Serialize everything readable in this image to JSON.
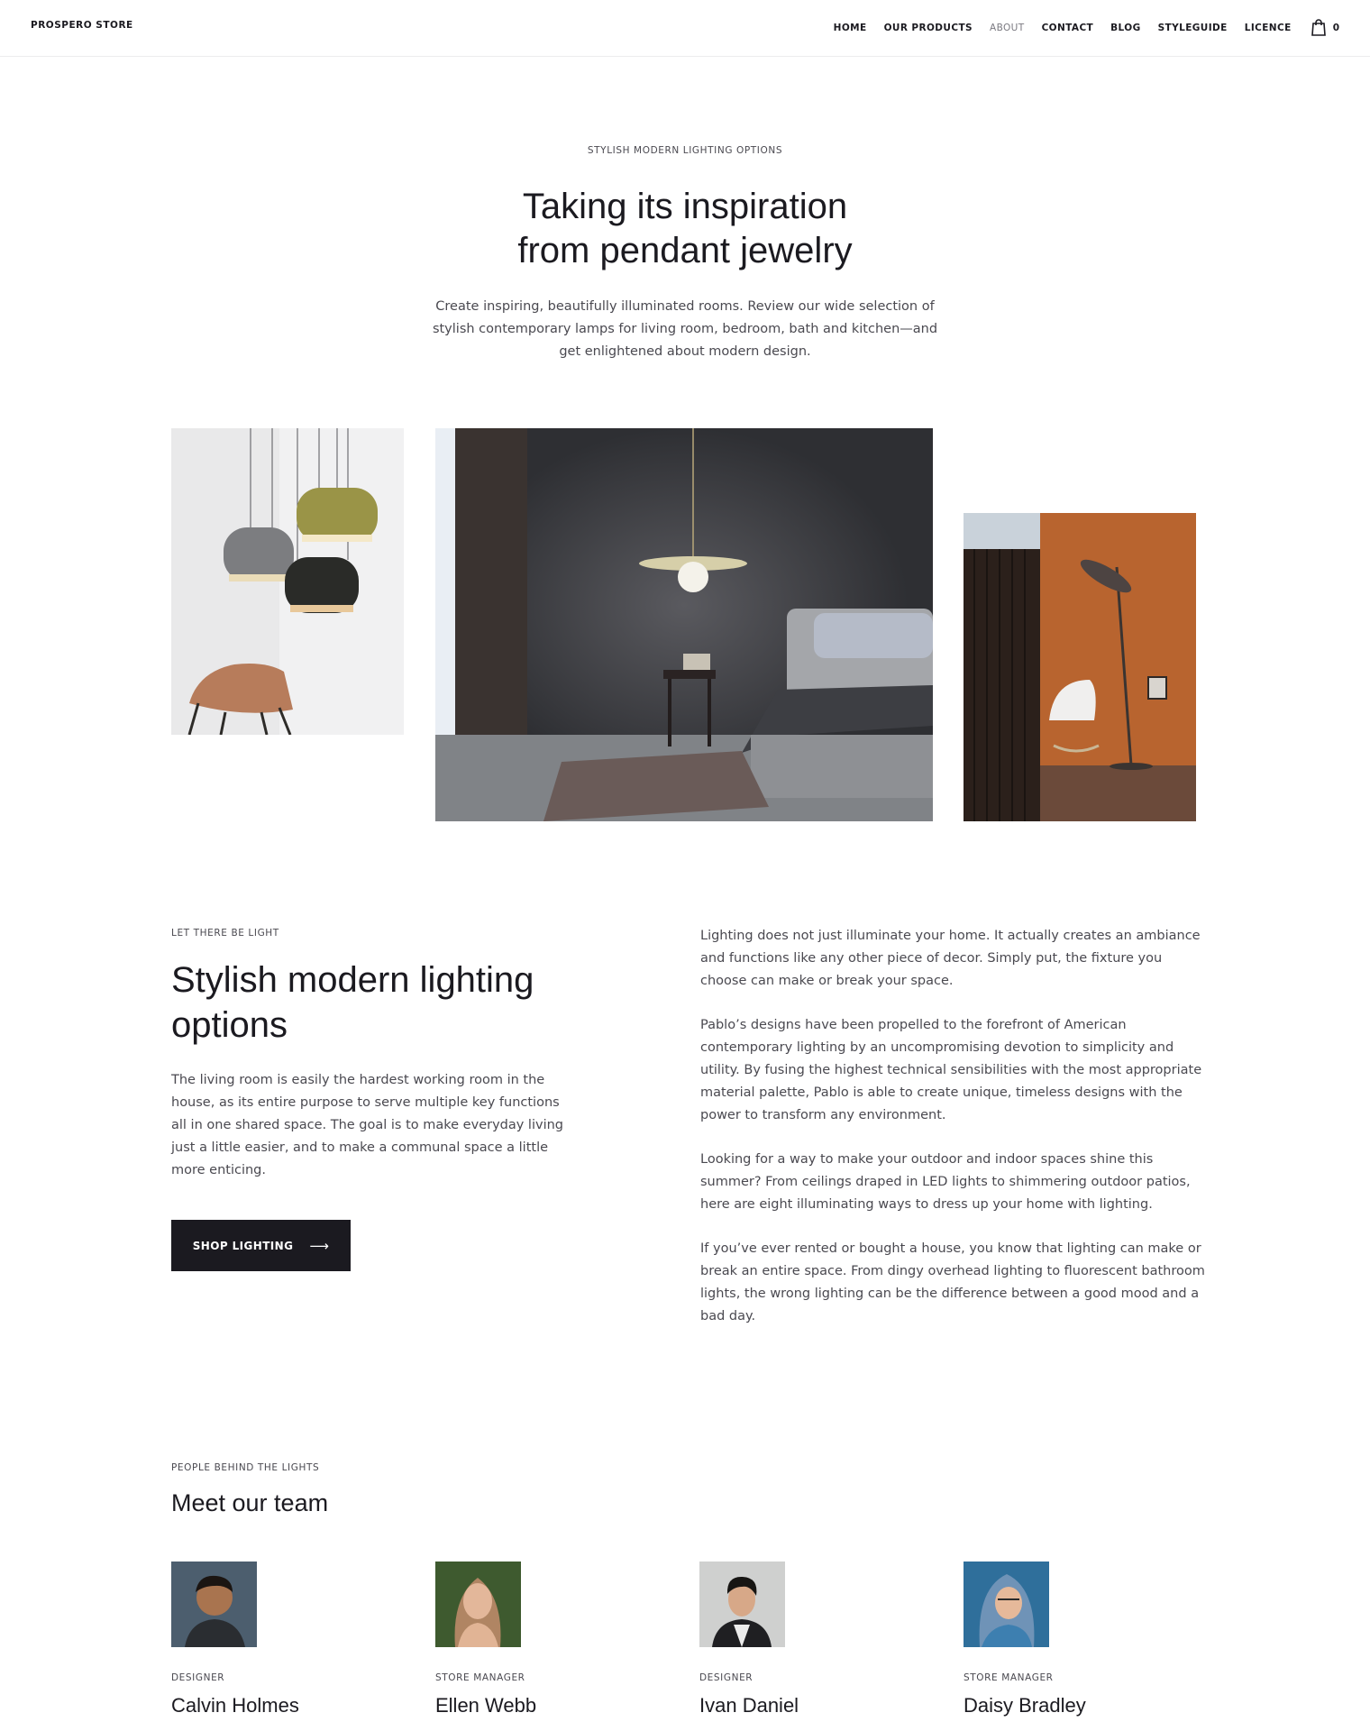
{
  "header": {
    "brand": "PROSPERO STORE",
    "nav": [
      "HOME",
      "OUR PRODUCTS",
      "ABOUT",
      "CONTACT",
      "BLOG",
      "STYLEGUIDE",
      "LICENCE"
    ],
    "active_nav": "ABOUT",
    "cart_icon": "shopping-bag-icon",
    "cart_count": "0"
  },
  "hero": {
    "kicker": "STYLISH MODERN LIGHTING OPTIONS",
    "title_line1": "Taking its inspiration",
    "title_line2": "from pendant jewelry",
    "text": "Create inspiring, beautifully illuminated rooms. Review our wide selection of stylish contemporary lamps for living room, bedroom, bath and kitchen—and get enlightened about modern design."
  },
  "gallery": [
    "pendant-lamps-with-chair-image",
    "bedroom-pendant-light-image",
    "floor-lamp-room-image"
  ],
  "lighting": {
    "kicker": "LET THERE BE LIGHT",
    "title": "Stylish modern lighting options",
    "body": "The living room is easily the hardest working room in the house, as its entire purpose to serve multiple key functions all in one shared space. The goal is to make everyday living just a little easier, and to make a communal space a little more enticing.",
    "button": "SHOP LIGHTING",
    "button_icon": "arrow-right-icon",
    "paragraphs": [
      "Lighting does not just illuminate your home. It actually creates an ambiance and functions like any other piece of decor. Simply put, the fixture you choose can make or break your space.",
      "Pablo’s designs have been propelled to the forefront of American contemporary lighting by an uncompromising devotion to simplicity and utility. By fusing the highest technical sensibilities with the most appropriate material palette, Pablo is able to create unique, timeless designs with the power to transform any environment.",
      "Looking for a way to make your outdoor and indoor spaces shine this summer? From ceilings draped in LED lights to shimmering outdoor patios, here are eight illuminating ways to dress up your home with lighting.",
      "If you’ve ever rented or bought a house, you know that lighting can make or break an entire space. From dingy overhead lighting to fluorescent bathroom lights, the wrong lighting can be the difference between a good mood and a bad day."
    ]
  },
  "team": {
    "kicker": "PEOPLE BEHIND THE LIGHTS",
    "title": "Meet our team",
    "members": [
      {
        "role": "DESIGNER",
        "name": "Calvin Holmes"
      },
      {
        "role": "STORE MANAGER",
        "name": "Ellen Webb"
      },
      {
        "role": "DESIGNER",
        "name": "Ivan Daniel"
      },
      {
        "role": "STORE MANAGER",
        "name": "Daisy Bradley"
      }
    ]
  },
  "colors": {
    "text": "#1b1a20",
    "muted": "#4a4950",
    "button_bg": "#1b1a20",
    "border": "#ececee"
  }
}
